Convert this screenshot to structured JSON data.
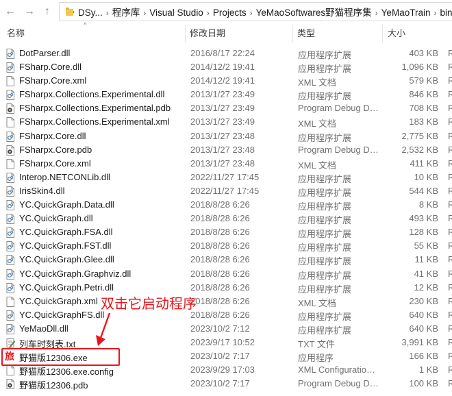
{
  "address": {
    "crumbs": [
      "DSy...",
      "程序库",
      "Visual Studio",
      "Projects",
      "YeMaoSoftwares野猫程序集",
      "YeMaoTrain",
      "bin",
      "R"
    ]
  },
  "columns": {
    "name": "名称",
    "date": "修改日期",
    "type": "类型",
    "size": "大小"
  },
  "files": [
    {
      "name": "DotParser.dll",
      "date": "2016/8/17 22:24",
      "type": "应用程序扩展",
      "size": "403 KB",
      "icon": "dll-icon"
    },
    {
      "name": "FSharp.Core.dll",
      "date": "2014/12/2 19:41",
      "type": "应用程序扩展",
      "size": "1,096 KB",
      "icon": "dll-icon"
    },
    {
      "name": "FSharp.Core.xml",
      "date": "2014/12/2 19:41",
      "type": "XML 文档",
      "size": "579 KB",
      "icon": "xml-icon"
    },
    {
      "name": "FSharpx.Collections.Experimental.dll",
      "date": "2013/1/27 23:49",
      "type": "应用程序扩展",
      "size": "846 KB",
      "icon": "dll-icon"
    },
    {
      "name": "FSharpx.Collections.Experimental.pdb",
      "date": "2013/1/27 23:49",
      "type": "Program Debug Da...",
      "size": "708 KB",
      "icon": "pdb-icon"
    },
    {
      "name": "FSharpx.Collections.Experimental.xml",
      "date": "2013/1/27 23:49",
      "type": "XML 文档",
      "size": "183 KB",
      "icon": "xml-icon"
    },
    {
      "name": "FSharpx.Core.dll",
      "date": "2013/1/27 23:48",
      "type": "应用程序扩展",
      "size": "2,775 KB",
      "icon": "dll-icon"
    },
    {
      "name": "FSharpx.Core.pdb",
      "date": "2013/1/27 23:48",
      "type": "Program Debug Da...",
      "size": "2,532 KB",
      "icon": "pdb-icon"
    },
    {
      "name": "FSharpx.Core.xml",
      "date": "2013/1/27 23:48",
      "type": "XML 文档",
      "size": "411 KB",
      "icon": "xml-icon"
    },
    {
      "name": "Interop.NETCONLib.dll",
      "date": "2022/11/27 17:45",
      "type": "应用程序扩展",
      "size": "10 KB",
      "icon": "dll-icon"
    },
    {
      "name": "IrisSkin4.dll",
      "date": "2022/11/27 17:45",
      "type": "应用程序扩展",
      "size": "544 KB",
      "icon": "dll-icon"
    },
    {
      "name": "YC.QuickGraph.Data.dll",
      "date": "2018/8/28 6:26",
      "type": "应用程序扩展",
      "size": "8 KB",
      "icon": "dll-icon"
    },
    {
      "name": "YC.QuickGraph.dll",
      "date": "2018/8/28 6:26",
      "type": "应用程序扩展",
      "size": "493 KB",
      "icon": "dll-icon"
    },
    {
      "name": "YC.QuickGraph.FSA.dll",
      "date": "2018/8/28 6:26",
      "type": "应用程序扩展",
      "size": "128 KB",
      "icon": "dll-icon"
    },
    {
      "name": "YC.QuickGraph.FST.dll",
      "date": "2018/8/28 6:26",
      "type": "应用程序扩展",
      "size": "55 KB",
      "icon": "dll-icon"
    },
    {
      "name": "YC.QuickGraph.Glee.dll",
      "date": "2018/8/28 6:26",
      "type": "应用程序扩展",
      "size": "11 KB",
      "icon": "dll-icon"
    },
    {
      "name": "YC.QuickGraph.Graphviz.dll",
      "date": "2018/8/28 6:26",
      "type": "应用程序扩展",
      "size": "41 KB",
      "icon": "dll-icon"
    },
    {
      "name": "YC.QuickGraph.Petri.dll",
      "date": "2018/8/28 6:26",
      "type": "应用程序扩展",
      "size": "12 KB",
      "icon": "dll-icon"
    },
    {
      "name": "YC.QuickGraph.xml",
      "date": "2018/8/28 6:26",
      "type": "XML 文档",
      "size": "230 KB",
      "icon": "xml-icon"
    },
    {
      "name": "YC.QuickGraphFS.dll",
      "date": "2018/8/28 6:26",
      "type": "应用程序扩展",
      "size": "640 KB",
      "icon": "dll-icon"
    },
    {
      "name": "YeMaoDll.dll",
      "date": "2023/10/2 7:12",
      "type": "应用程序扩展",
      "size": "640 KB",
      "icon": "dll-icon"
    },
    {
      "name": "列车时刻表.txt",
      "date": "2023/9/17 10:52",
      "type": "TXT 文件",
      "size": "3,991 KB",
      "icon": "txt-icon"
    },
    {
      "name": "野猫版12306.exe",
      "date": "2023/10/2 7:17",
      "type": "应用程序",
      "size": "166 KB",
      "icon": "app-exe-icon"
    },
    {
      "name": "野猫版12306.exe.config",
      "date": "2023/9/29 17:03",
      "type": "XML Configuration ...",
      "size": "1 KB",
      "icon": "config-icon"
    },
    {
      "name": "野猫版12306.pdb",
      "date": "2023/10/2 7:17",
      "type": "Program Debug Da...",
      "size": "100 KB",
      "icon": "pdb-icon"
    }
  ],
  "overflow_letter": "R",
  "annotation": {
    "text": "双击它启动程序",
    "color": "#e8161b"
  },
  "exe_icon_glyph": "旅",
  "colors": {
    "accent": "#e8161b",
    "folder": "#f2c94c",
    "meta_text": "#707070"
  }
}
